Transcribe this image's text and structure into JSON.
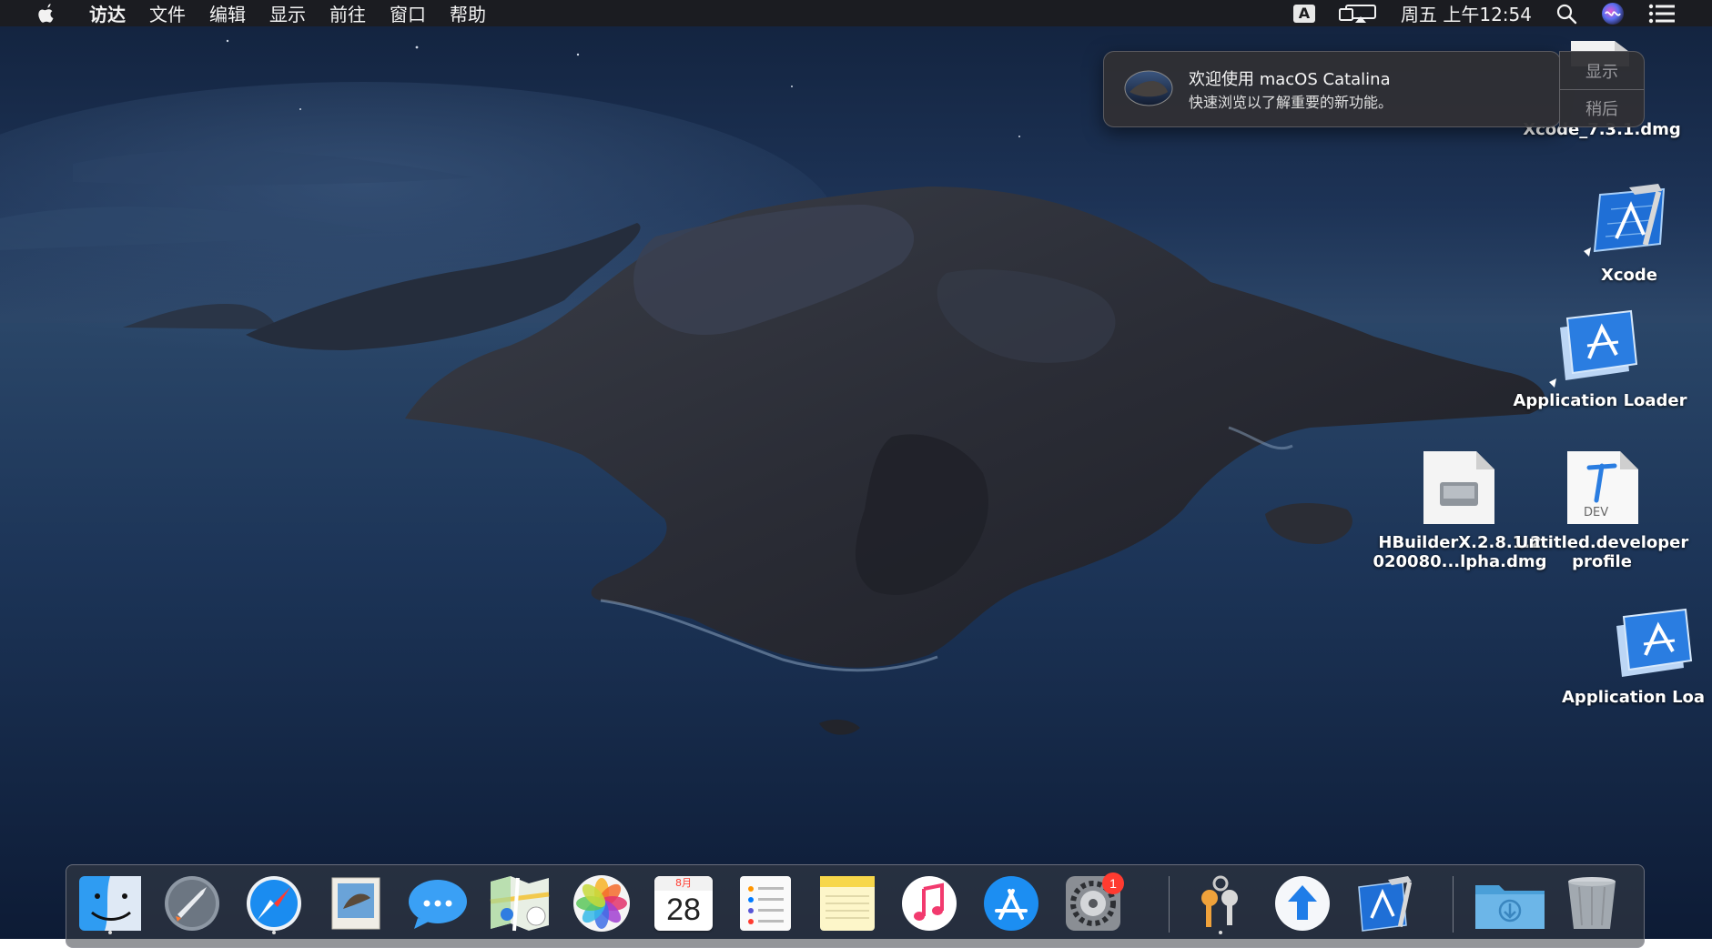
{
  "menubar": {
    "app_name": "访达",
    "items": [
      "文件",
      "编辑",
      "显示",
      "前往",
      "窗口",
      "帮助"
    ],
    "input_method": "A",
    "clock": "周五 上午12:54"
  },
  "notification": {
    "title": "欢迎使用 macOS Catalina",
    "body": "快速浏览以了解重要的新功能。",
    "show_button": "显示",
    "later_button": "稍后"
  },
  "desktop_icons": {
    "xcode_dmg": "Xcode_7.3.1.dmg",
    "xcode": "Xcode",
    "app_loader_1": "Application Loader",
    "hbuilder_line1": "HBuilderX.2.8.1.2",
    "hbuilder_line2": "020080...lpha.dmg",
    "dev_profile_line1": "Untitled.developer",
    "dev_profile_line2": "profile",
    "dev_profile_tag": "DEV",
    "app_loader_2": "Application Loa"
  },
  "dock": {
    "calendar_month": "8月",
    "calendar_day": "28",
    "settings_badge": "1",
    "items": [
      "finder-icon",
      "launchpad-icon",
      "safari-icon",
      "mail-icon",
      "messages-icon",
      "maps-icon",
      "photos-icon",
      "calendar-icon",
      "reminders-icon",
      "notes-icon",
      "music-icon",
      "app-store-icon",
      "system-preferences-icon",
      "keychain-icon",
      "upload-icon",
      "xcode-icon",
      "downloads-folder-icon",
      "trash-icon"
    ]
  }
}
